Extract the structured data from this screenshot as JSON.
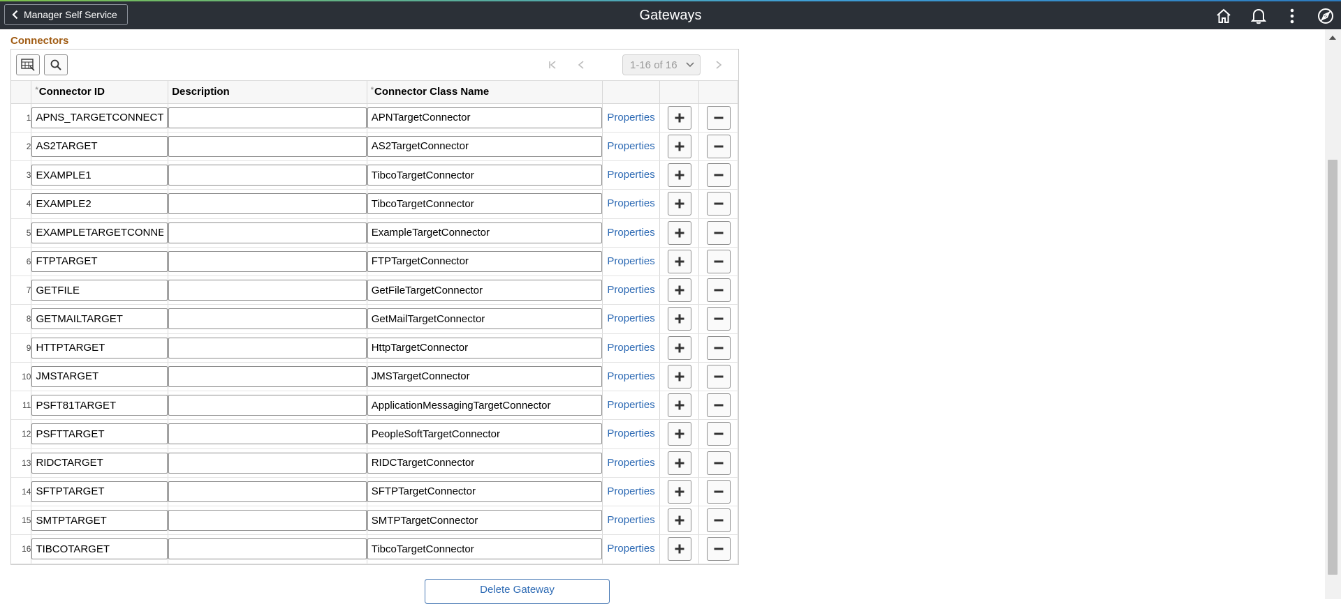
{
  "header": {
    "back_label": "Manager Self Service",
    "title": "Gateways"
  },
  "section": {
    "title": "Connectors"
  },
  "pager": {
    "range": "1-16 of 16"
  },
  "columns": {
    "connector_id": "Connector ID",
    "description": "Description",
    "class_name": "Connector Class Name",
    "required_marker": "*"
  },
  "properties_label": "Properties",
  "rows": [
    {
      "num": "1",
      "id": "APNS_TARGETCONNECTOR",
      "description": "",
      "class_name": "APNTargetConnector"
    },
    {
      "num": "2",
      "id": "AS2TARGET",
      "description": "",
      "class_name": "AS2TargetConnector"
    },
    {
      "num": "3",
      "id": "EXAMPLE1",
      "description": "",
      "class_name": "TibcoTargetConnector"
    },
    {
      "num": "4",
      "id": "EXAMPLE2",
      "description": "",
      "class_name": "TibcoTargetConnector"
    },
    {
      "num": "5",
      "id": "EXAMPLETARGETCONNECTOR",
      "description": "",
      "class_name": "ExampleTargetConnector"
    },
    {
      "num": "6",
      "id": "FTPTARGET",
      "description": "",
      "class_name": "FTPTargetConnector"
    },
    {
      "num": "7",
      "id": "GETFILE",
      "description": "",
      "class_name": "GetFileTargetConnector"
    },
    {
      "num": "8",
      "id": "GETMAILTARGET",
      "description": "",
      "class_name": "GetMailTargetConnector"
    },
    {
      "num": "9",
      "id": "HTTPTARGET",
      "description": "",
      "class_name": "HttpTargetConnector"
    },
    {
      "num": "10",
      "id": "JMSTARGET",
      "description": "",
      "class_name": "JMSTargetConnector"
    },
    {
      "num": "11",
      "id": "PSFT81TARGET",
      "description": "",
      "class_name": "ApplicationMessagingTargetConnector"
    },
    {
      "num": "12",
      "id": "PSFTTARGET",
      "description": "",
      "class_name": "PeopleSoftTargetConnector"
    },
    {
      "num": "13",
      "id": "RIDCTARGET",
      "description": "",
      "class_name": "RIDCTargetConnector"
    },
    {
      "num": "14",
      "id": "SFTPTARGET",
      "description": "",
      "class_name": "SFTPTargetConnector"
    },
    {
      "num": "15",
      "id": "SMTPTARGET",
      "description": "",
      "class_name": "SMTPTargetConnector"
    },
    {
      "num": "16",
      "id": "TIBCOTARGET",
      "description": "",
      "class_name": "TibcoTargetConnector"
    }
  ],
  "footer": {
    "delete_label": "Delete Gateway"
  },
  "colors": {
    "header_bg": "#2b3037",
    "section_title": "#a05b12",
    "link": "#2d6ab4"
  }
}
